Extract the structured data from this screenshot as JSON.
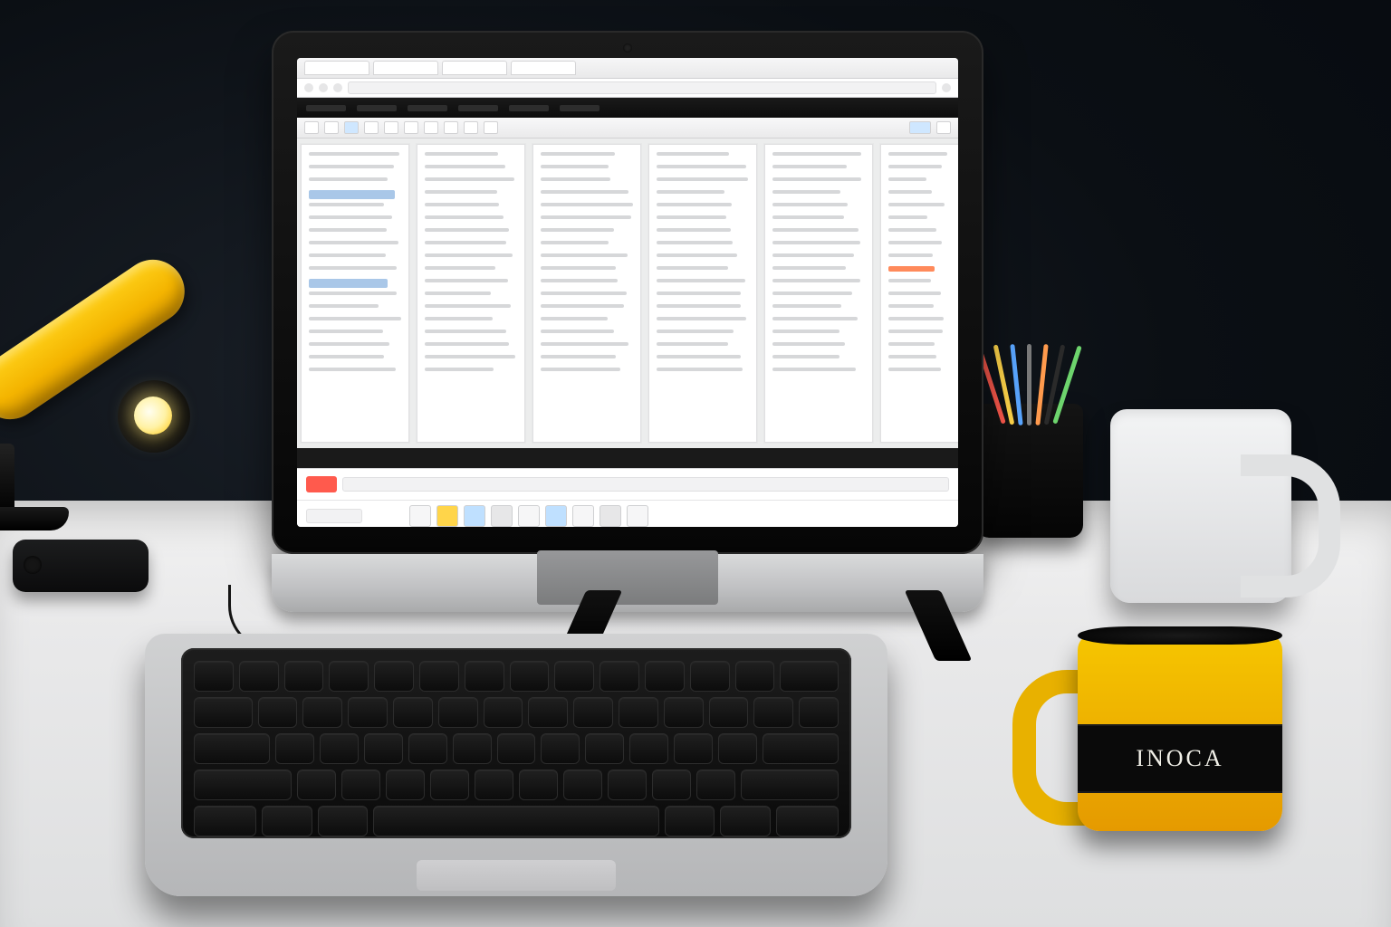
{
  "scene": {
    "description": "Stylized photo/render of a desk workspace: iMac-style monitor showing a multi-column application, laptop keyboard in front, yellow desk lamp, pen cup, white mug, yellow-and-black mug.",
    "mug_text": "INOCA",
    "lamp_color": "#f6c600",
    "pens": [
      "#ff5a4d",
      "#ffd54a",
      "#5aa6ff",
      "#7b7b7b",
      "#ff9a4d",
      "#2a2a2a",
      "#6dd46d"
    ]
  },
  "monitor_app": {
    "note": "On-screen text is not legibly resolvable in the source image; layout is reproduced with placeholder lines only.",
    "browser_tabs": [
      "",
      "",
      "",
      ""
    ],
    "ribbon_accent": "#cfe7ff",
    "columns": 6,
    "accent_blue": "#a9c7e8",
    "accent_orange": "#ff8a5b",
    "footer_badge_color": "#ff5a4d",
    "bottom_chips": [
      "plain",
      "yellow",
      "blue",
      "grey",
      "plain",
      "blue",
      "plain",
      "grey",
      "plain"
    ]
  },
  "laptop": {
    "key_rows": 5
  }
}
